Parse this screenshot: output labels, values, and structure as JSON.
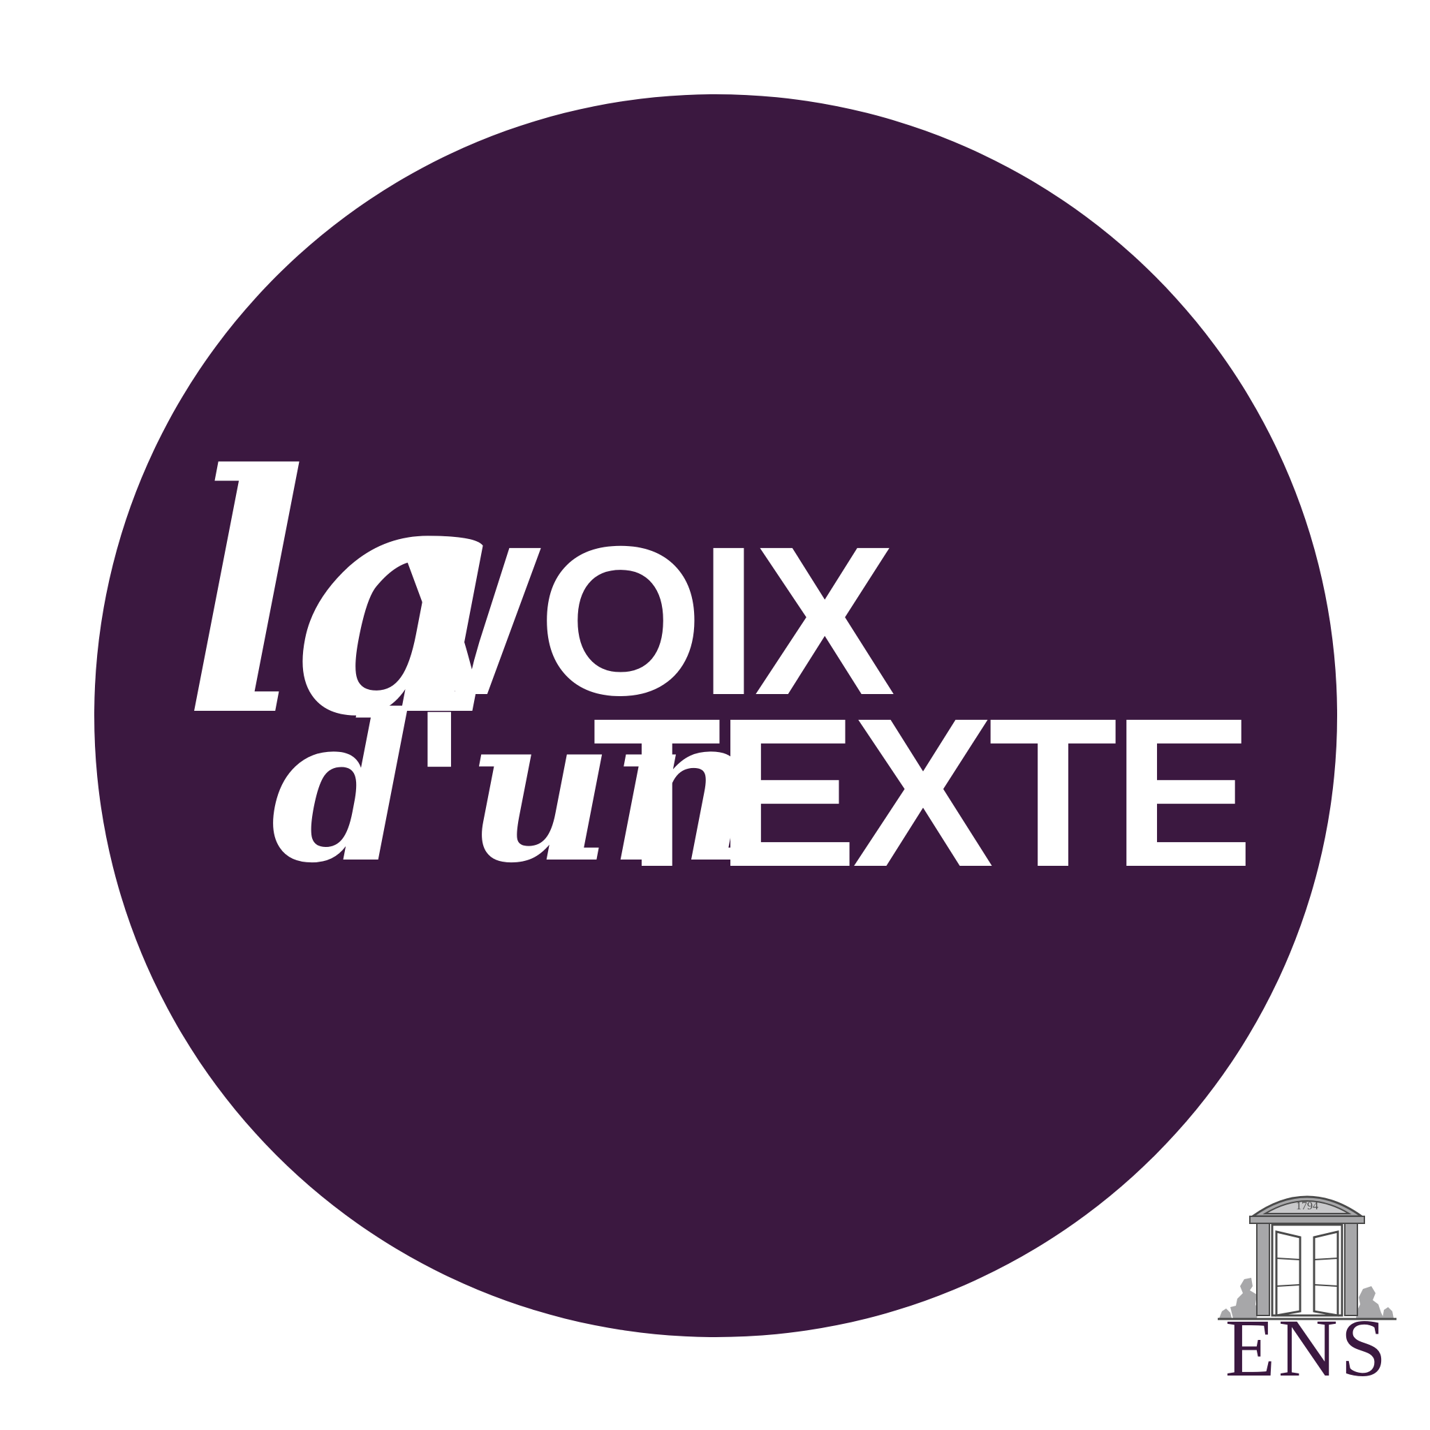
{
  "logo": {
    "line1_script": "la",
    "line1_bold": "VOIX",
    "line2_script": "d'un",
    "line2_bold": "TEXTE"
  },
  "ens": {
    "year": "1794",
    "letters": "ENS"
  },
  "colors": {
    "disc": "#3b1840",
    "text": "#ffffff",
    "background": "#ffffff",
    "ens_grey": "#a7a7a9",
    "ens_purple": "#3b1840"
  }
}
